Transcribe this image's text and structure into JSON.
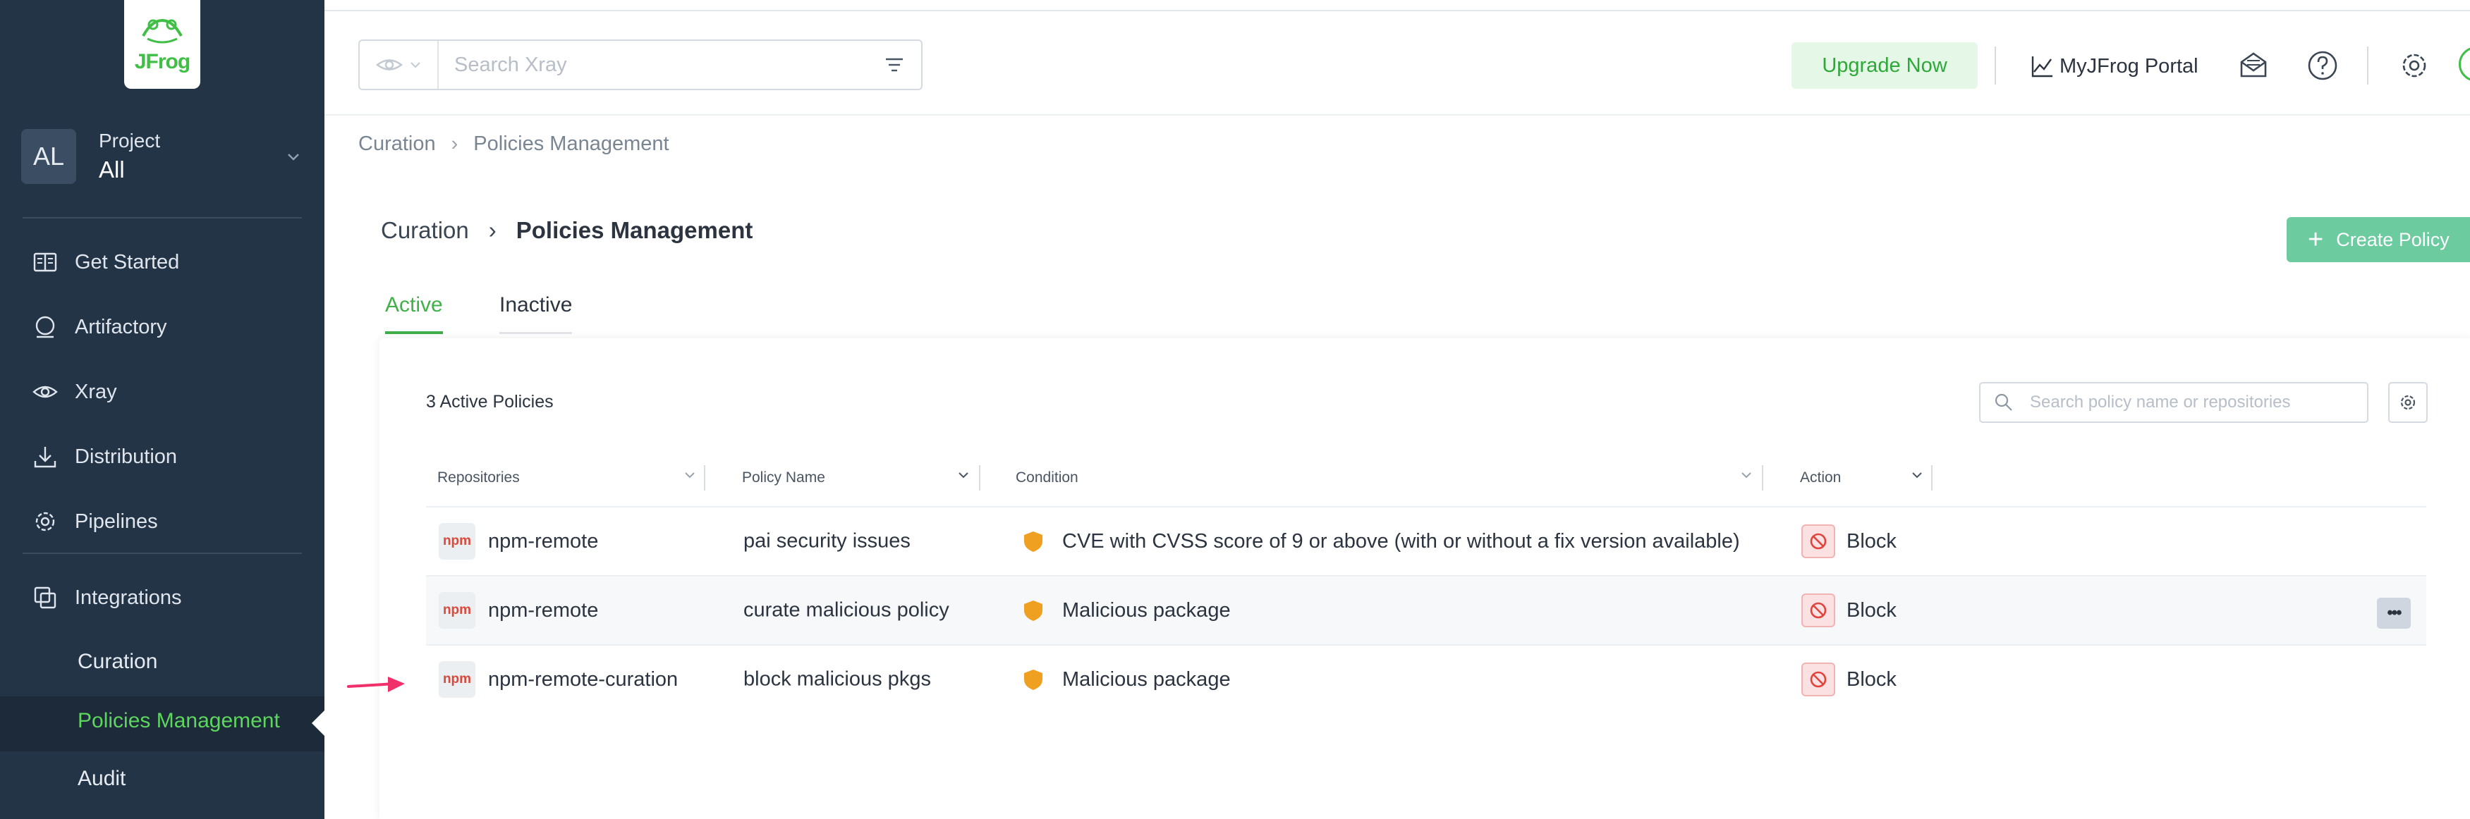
{
  "sidebar": {
    "logo_text": "JFrog",
    "avatar_initials": "AL",
    "project_label": "Project",
    "project_value": "All",
    "nav": [
      {
        "label": "Get Started",
        "icon": "book-icon"
      },
      {
        "label": "Artifactory",
        "icon": "circle-icon"
      },
      {
        "label": "Xray",
        "icon": "eye-icon"
      },
      {
        "label": "Distribution",
        "icon": "download-icon"
      },
      {
        "label": "Pipelines",
        "icon": "gear-icon"
      },
      {
        "label": "Integrations",
        "icon": "integrations-icon"
      }
    ],
    "sub": {
      "curation": "Curation",
      "policies": "Policies Management",
      "audit": "Audit"
    }
  },
  "topbar": {
    "search_placeholder": "Search Xray",
    "upgrade_label": "Upgrade Now",
    "portal_label": "MyJFrog Portal"
  },
  "breadcrumb": {
    "first": "Curation",
    "current": "Policies Management"
  },
  "page": {
    "crumb_first": "Curation",
    "crumb_current": "Policies Management",
    "create_label": "Create Policy"
  },
  "tabs": {
    "active": "Active",
    "inactive": "Inactive"
  },
  "table": {
    "count_label": "3 Active Policies",
    "search_placeholder": "Search policy name or repositories",
    "headers": {
      "repositories": "Repositories",
      "policy_name": "Policy Name",
      "condition": "Condition",
      "action": "Action"
    },
    "rows": [
      {
        "badge": "npm",
        "repository": "npm-remote",
        "policy": "pai security issues",
        "condition": "CVE with CVSS score of 9 or above (with or without a fix version available)",
        "action": "Block"
      },
      {
        "badge": "npm",
        "repository": "npm-remote",
        "policy": "curate malicious policy",
        "condition": "Malicious package",
        "action": "Block"
      },
      {
        "badge": "npm",
        "repository": "npm-remote-curation",
        "policy": "block malicious pkgs",
        "condition": "Malicious package",
        "action": "Block"
      }
    ]
  },
  "colors": {
    "sidebar_bg": "#243447",
    "accent_green": "#40b04a",
    "create_button": "#6ccca0",
    "block_red": "#e0443c",
    "shield_orange": "#f0a020",
    "arrow_pink": "#f0306a"
  }
}
